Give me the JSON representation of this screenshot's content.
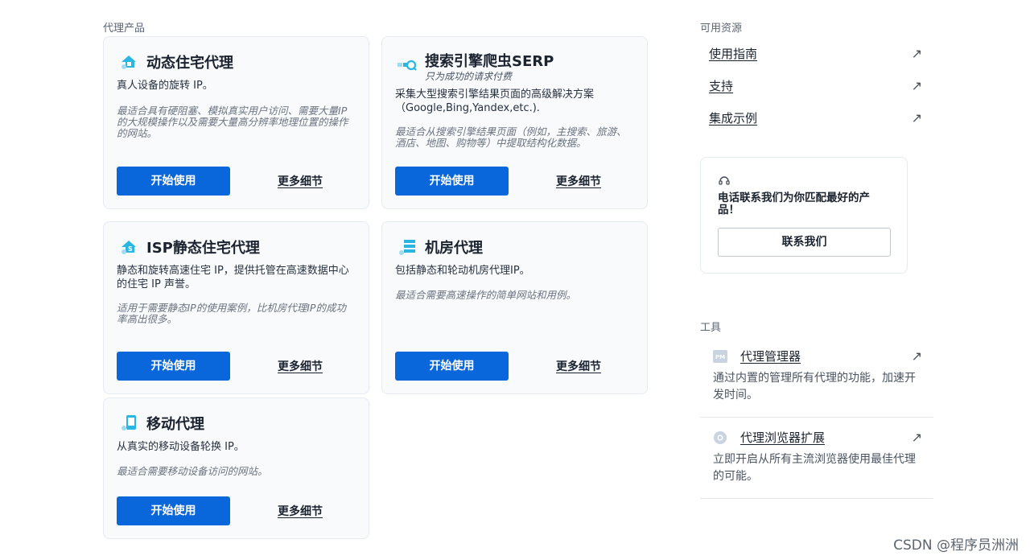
{
  "products_label": "代理产品",
  "cards": [
    {
      "title": "动态住宅代理",
      "subtitle": "",
      "desc": "真人设备的旋转 IP。",
      "best": "最适合具有硬阻塞、模拟真实用户访问、需要大量IP 的大规模操作以及需要大量高分辨率地理位置的操作的网站。",
      "start": "开始使用",
      "more": "更多细节",
      "icon": "home-location-icon"
    },
    {
      "title": "搜索引擎爬虫SERP",
      "subtitle": "只为成功的请求付费",
      "desc": "采集大型搜索引擎结果页面的高级解决方案（Google,Bing,Yandex,etc.).",
      "best": "最适合从搜索引擎结果页面（例如，主搜索、旅游、酒店、地图、购物等）中提取结构化数据。",
      "start": "开始使用",
      "more": "更多细节",
      "icon": "search-engine-icon"
    },
    {
      "title": "ISP静态住宅代理",
      "subtitle": "",
      "desc": "静态和旋转高速住宅 IP，提供托管在高速数据中心的住宅 IP 声誉。",
      "best": "适用于需要静态IP的使用案例，比机房代理IP的成功率高出很多。",
      "start": "开始使用",
      "more": "更多细节",
      "icon": "isp-home-icon"
    },
    {
      "title": "机房代理",
      "subtitle": "",
      "desc": "包括静态和轮动机房代理IP。",
      "best": "最适合需要高速操作的简单网站和用例。",
      "start": "开始使用",
      "more": "更多细节",
      "icon": "datacenter-icon"
    },
    {
      "title": "移动代理",
      "subtitle": "",
      "desc": "从真实的移动设备轮换 IP。",
      "best": "最适合需要移动设备访问的网站。",
      "start": "开始使用",
      "more": "更多细节",
      "icon": "mobile-device-icon"
    }
  ],
  "resources_label": "可用资源",
  "resources": [
    {
      "label": "使用指南"
    },
    {
      "label": "支持"
    },
    {
      "label": "集成示例"
    }
  ],
  "contact": {
    "text": "电话联系我们为你匹配最好的产品！",
    "button": "联系我们",
    "icon": "headset-icon"
  },
  "tools_label": "工具",
  "tools": [
    {
      "label": "代理管理器",
      "desc": "通过内置的管理所有代理的功能，加速开发时间。",
      "icon": "pm-icon"
    },
    {
      "label": "代理浏览器扩展",
      "desc": "立即开启从所有主流浏览器使用最佳代理的可能。",
      "icon": "browser-extension-icon"
    }
  ],
  "watermark": "CSDN @程序员洲洲",
  "colors": {
    "primary": "#0a67db",
    "accent": "#29b6e3",
    "card_bg": "#f8fafc"
  }
}
